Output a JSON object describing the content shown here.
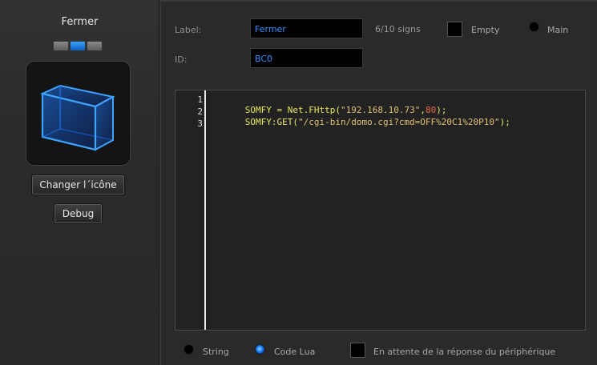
{
  "device": {
    "title": "Fermer",
    "change_icon_label": "Changer l´icône",
    "debug_label": "Debug",
    "icon": "cube-icon"
  },
  "form": {
    "label_caption": "Label:",
    "label_value": "Fermer",
    "char_count": "6/10 signs",
    "empty_label": "Empty",
    "main_label": "Main",
    "id_caption": "ID:",
    "id_value": "BC0"
  },
  "editor": {
    "lines": [
      {
        "num": "1",
        "tokens": [
          {
            "t": "SOMFY",
            "k": "id"
          },
          {
            "t": " = ",
            "k": "op"
          },
          {
            "t": "Net.FHttp(",
            "k": "id"
          },
          {
            "t": "\"192.168.10.73\"",
            "k": "str"
          },
          {
            "t": ",",
            "k": "op"
          },
          {
            "t": "80",
            "k": "num"
          },
          {
            "t": ");",
            "k": "op"
          }
        ]
      },
      {
        "num": "2",
        "tokens": [
          {
            "t": "SOMFY:GET(",
            "k": "id"
          },
          {
            "t": "\"/cgi-bin/domo.cgi?cmd=OFF%20C1%20P10\"",
            "k": "str"
          },
          {
            "t": ");",
            "k": "op"
          }
        ]
      },
      {
        "num": "3",
        "tokens": []
      }
    ]
  },
  "footer": {
    "string_label": "String",
    "lua_label": "Code Lua",
    "wait_label": "En attente de la réponse du périphérique"
  },
  "colors": {
    "accent": "#1a84ff",
    "field_text": "#2f8fff"
  }
}
